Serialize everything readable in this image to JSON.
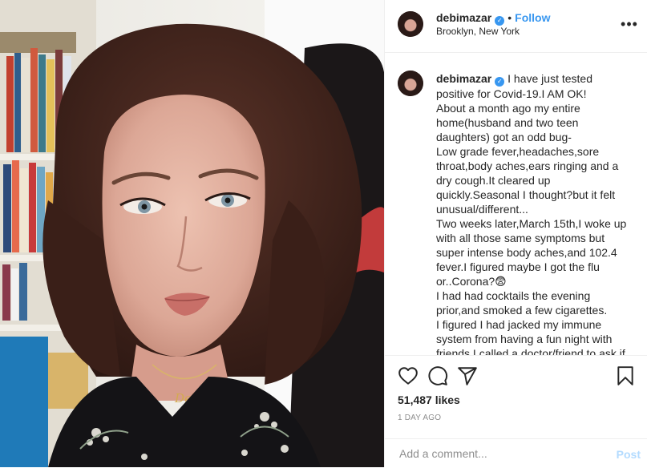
{
  "header": {
    "username": "debimazar",
    "follow_label": "Follow",
    "separator": "•",
    "location": "Brooklyn, New York",
    "more_icon": "more-horizontal-icon",
    "verified_icon": "verified-badge-icon"
  },
  "caption": {
    "username": "debimazar",
    "paragraphs": [
      "I have just tested positive for Covid-19.I AM OK!",
      "About a month ago my entire home(husband and two teen daughters) got an odd bug-",
      "Low grade fever,headaches,sore throat,body aches,ears ringing and a dry cough.It cleared up quickly.Seasonal I thought?but it felt unusual/different...",
      "Two weeks later,March 15th,I woke up with all those same symptoms but super intense body aches,and 102.4 fever.I figured maybe I got the flu or..Corona?😨",
      "I had had cocktails the evening prior,and smoked a few cigarettes.",
      "I figured I had jacked my immune system from having a fun night with friends.I called a doctor/friend to ask if"
    ]
  },
  "actions": {
    "icons": [
      "heart-icon",
      "comment-icon",
      "share-icon",
      "bookmark-icon"
    ]
  },
  "likes": "51,487 likes",
  "timestamp": "1 DAY AGO",
  "comment": {
    "placeholder": "Add a comment...",
    "post_label": "Post"
  },
  "colors": {
    "link_blue": "#3897f0",
    "post_disabled": "#b3dbff",
    "muted": "#8e8e8e",
    "border": "#efefef"
  }
}
